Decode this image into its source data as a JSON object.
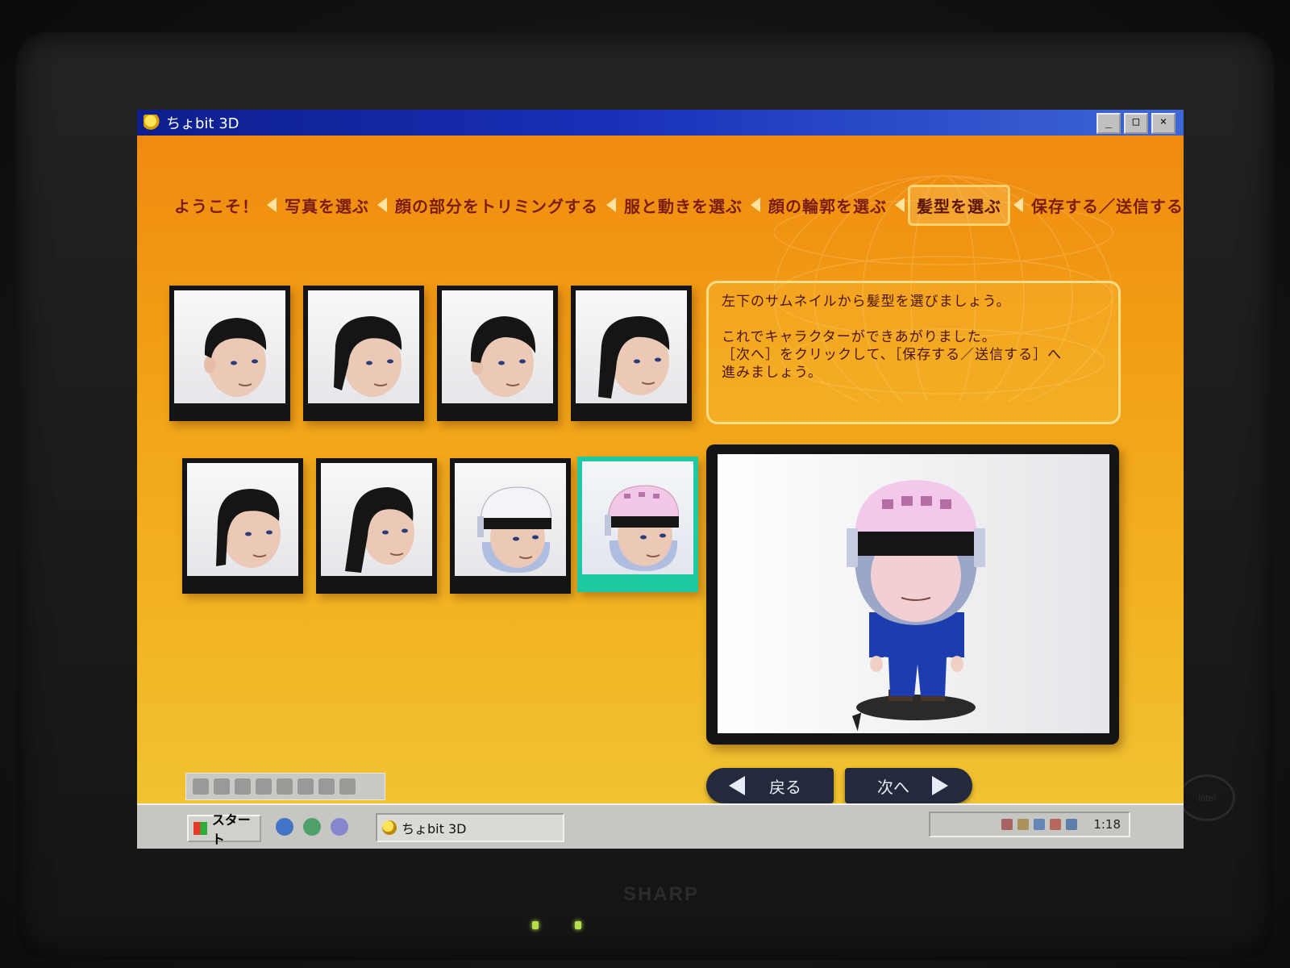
{
  "window": {
    "title": "ちょbit 3D",
    "controls": [
      "_",
      "□",
      "×"
    ]
  },
  "steps": [
    {
      "label": "ようこそ！",
      "active": false
    },
    {
      "label": "写真を選ぶ",
      "active": false
    },
    {
      "label": "顔の部分をトリミングする",
      "active": false
    },
    {
      "label": "服と動きを選ぶ",
      "active": false
    },
    {
      "label": "顔の輪郭を選ぶ",
      "active": false
    },
    {
      "label": "髪型を選ぶ",
      "active": true
    },
    {
      "label": "保存する／送信する",
      "active": false
    }
  ],
  "thumbnails": [
    {
      "hair": "short",
      "selected": false
    },
    {
      "hair": "layered",
      "selected": false
    },
    {
      "hair": "bob",
      "selected": false
    },
    {
      "hair": "long",
      "selected": false
    },
    {
      "hair": "spiky",
      "selected": false
    },
    {
      "hair": "long-straight",
      "selected": false
    },
    {
      "hair": "helmet-white",
      "selected": false
    },
    {
      "hair": "helmet-pink",
      "selected": true
    }
  ],
  "instructions": {
    "line1": "左下のサムネイルから髪型を選びましょう。",
    "line2": "これでキャラクターができあがりました。",
    "line3": "［次へ］をクリックして、［保存する／送信する］へ",
    "line4": "進みましょう。"
  },
  "nav": {
    "back_label": "戻る",
    "next_label": "次へ"
  },
  "taskbar": {
    "start_label": "スタート",
    "task_label": "ちょbit 3D",
    "clock": "1:18"
  },
  "monitor": {
    "brand": "SHARP",
    "badge": "intel"
  },
  "colors": {
    "app_bg_top": "#f08a10",
    "app_bg_bottom": "#f1c232",
    "selected_frame": "#1ec9a3",
    "title_bar": "#1830b8"
  }
}
